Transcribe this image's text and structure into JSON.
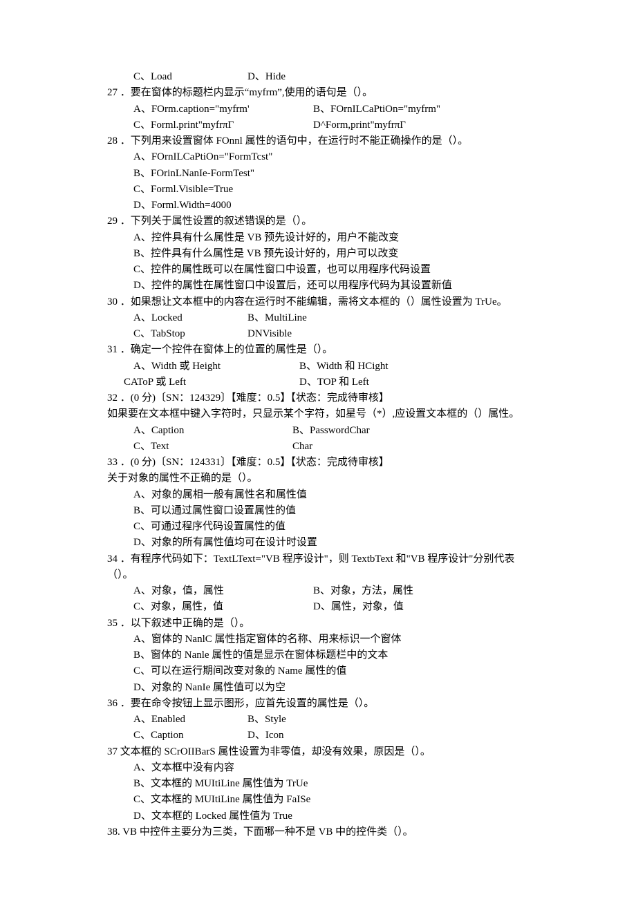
{
  "lines": {
    "q26_c": "C、Load",
    "q26_d": "D、Hide",
    "q27": "27 ．要在窗体的标题栏内显示“myfrm”,使用的语句是（）。",
    "q27_a": "A、FOrm.caption=\"myfrm'",
    "q27_b": "B、FOrnILCaPtiOn=\"myfrm\"",
    "q27_c": "C、Forml.print\"myfrπΓ",
    "q27_d": "D^Form,print\"myfrπΓ",
    "q28": "28 ．下列用来设置窗体 FOnnl 属性的语句中，在运行时不能正确操作的是（）。",
    "q28_a": "A、FOrnILCaPtiOn=\"FormTcst\"",
    "q28_b": "B、FOrinLNanIe-FormTest\"",
    "q28_c": "C、Forml.Visible=True",
    "q28_d": "D、Forml.Width=4000",
    "q29": "29 ．下列关于属性设置的叙述错误的是（）。",
    "q29_a": "A、控件具有什么属性是 VB 预先设计好的，用户不能改变",
    "q29_b": "B、控件具有什么属性是 VB 预先设计好的，用户可以改变",
    "q29_c": "C、控件的属性既可以在属性窗口中设置，也可以用程序代码设置",
    "q29_d": "D、控件的属性在属性窗口中设置后，还可以用程序代码为其设置新值",
    "q30": "30 ．如果想让文本框中的内容在运行时不能编辑，需将文本框的（）属性设置为 TrUe。",
    "q30_a": "A、Locked",
    "q30_b": "B、MultiLine",
    "q30_c": "C、TabStop",
    "q30_d": "DNVisible",
    "q31": "31 ．确定一个控件在窗体上的位置的属性是（）。",
    "q31_a": "A、Width 或 Height",
    "q31_b": "B、Width 和 HCight",
    "q31_c": "CAToP 或 Left",
    "q31_d": "D、TOP 和 Left",
    "q32": "32 ．(0 分)〔SN：124329〕【难度：0.5】【状态：完成待审核】",
    "q32_body": "如果要在文本框中键入字符时，只显示某个字符，如星号（*）,应设置文本框的（）属性。",
    "q32_a": "A、Caption",
    "q32_b": "B、PasswordChar",
    "q32_c": "C、Text",
    "q32_d": "Char",
    "q33": "33 ．(0 分)〔SN：124331〕【难度：0.5】【状态：完成待审核】",
    "q33_body": "关于对象的属性不正确的是（）。",
    "q33_a": "A、对象的属相一般有属性名和属性值",
    "q33_b": "B、可以通过属性窗口设置属性的值",
    "q33_c": "C、可通过程序代码设置属性的值",
    "q33_d": "D、对象的所有属性值均可在设计时设置",
    "q34": "34 ．有程序代码如下：TextLText=\"VB 程序设计\"，则 TextbText 和\"VB 程序设计\"分别代表（）。",
    "q34_a": "A、对象，值，属性",
    "q34_b": "B、对象，方法，属性",
    "q34_c": "C、对象，属性，值",
    "q34_d": "D、属性，对象，值",
    "q35": "35 ．以下叙述中正确的是（）。",
    "q35_a": "A、窗体的 NanlC 属性指定窗体的名称、用来标识一个窗体",
    "q35_b": "B、窗体的 Nanle 属性的值是显示在窗体标题栏中的文本",
    "q35_c": "C、可以在运行期间改变对象的 Name 属性的值",
    "q35_d": "D、对象的 NanIe 属性值可以为空",
    "q36": "36 ．要在命令按钮上显示图形，应首先设置的属性是（）。",
    "q36_a": "A、Enabled",
    "q36_b": "B、Style",
    "q36_c": "C、Caption",
    "q36_d": "D、Icon",
    "q37": "37 文本框的 SCrOIIBarS 属性设置为非零值，却没有效果，原因是（）。",
    "q37_a": "A、文本框中没有内容",
    "q37_b": "B、文本框的 MUItiLine 属性值为 TrUe",
    "q37_c": "C、文本框的 MUItiLine 属性值为 FaISe",
    "q37_d": "D、文本框的 Locked 属性值为 True",
    "q38": "38.  VB 中控件主要分为三类，下面哪一种不是 VB 中的控件类（）。"
  }
}
